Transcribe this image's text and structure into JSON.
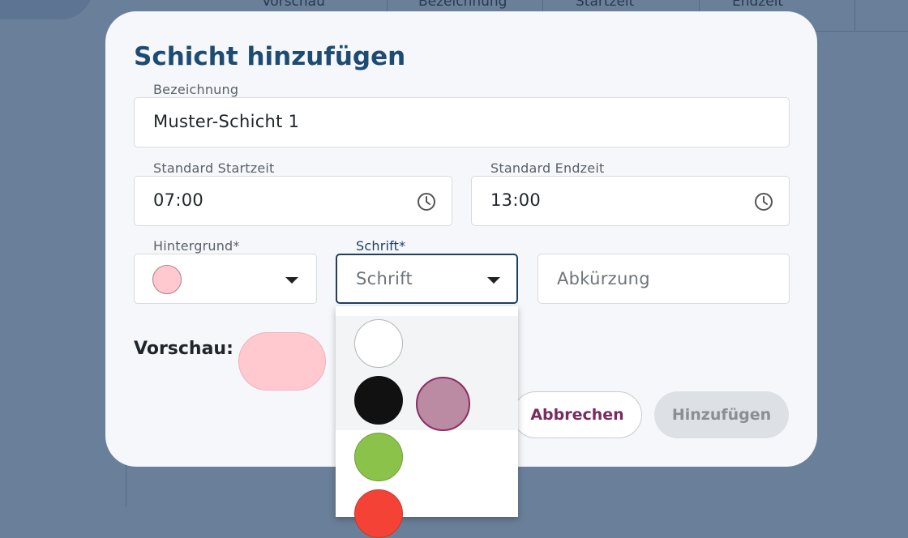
{
  "background": {
    "table_headers": [
      "Vorschau",
      "Bezeichnung",
      "Startzeit",
      "Endzeit"
    ]
  },
  "dialog": {
    "title": "Schicht hinzufügen",
    "bezeichnung": {
      "label": "Bezeichnung",
      "value": "Muster-Schicht 1"
    },
    "startzeit": {
      "label": "Standard Startzeit",
      "value": "07:00",
      "icon": "clock-icon"
    },
    "endzeit": {
      "label": "Standard Endzeit",
      "value": "13:00",
      "icon": "clock-icon"
    },
    "hintergrund": {
      "label": "Hintergrund*",
      "selected_color": "#ffc9cf"
    },
    "schrift": {
      "label": "Schrift*",
      "placeholder": "Schrift",
      "open": true
    },
    "abkuerzung": {
      "placeholder": "Abkürzung"
    },
    "preview": {
      "label": "Vorschau:",
      "color": "#ffc9cf"
    },
    "buttons": {
      "cancel": "Abbrechen",
      "add": "Hinzufügen"
    }
  },
  "font_color_options": [
    {
      "name": "white",
      "color": "#ffffff"
    },
    {
      "name": "black",
      "color": "#111111"
    },
    {
      "name": "mauve",
      "color": "#bb8aa3"
    },
    {
      "name": "green",
      "color": "#8bc34a"
    },
    {
      "name": "red",
      "color": "#f44336"
    }
  ],
  "colors": {
    "title": "#1e4b72",
    "accent_text": "#7a2b5f",
    "focus_border": "#1e3f5e"
  }
}
